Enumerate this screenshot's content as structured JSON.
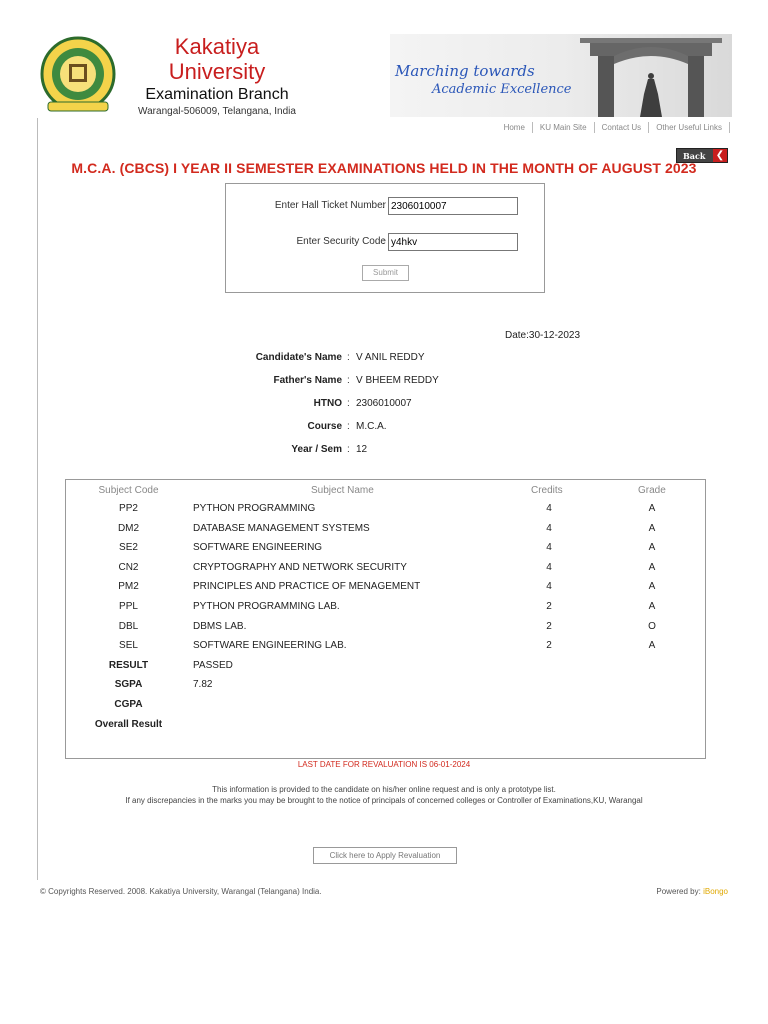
{
  "header": {
    "university_line1": "Kakatiya",
    "university_line2": "University",
    "branch": "Examination Branch",
    "address": "Warangal-506009, Telangana, India",
    "banner_line1": "Marching towards",
    "banner_line2": "Academic Excellence"
  },
  "nav": {
    "items": [
      "Home",
      "KU Main Site",
      "Contact Us",
      "Other Useful Links"
    ]
  },
  "back_label": "Back",
  "exam_title": "M.C.A. (CBCS) I YEAR II SEMESTER EXAMINATIONS HELD IN THE MONTH OF AUGUST 2023",
  "form": {
    "hall_ticket_label": "Enter Hall Ticket Number",
    "hall_ticket_value": "2306010007",
    "security_label": "Enter Security Code",
    "security_value": "y4hkv",
    "submit_label": "Submit"
  },
  "date": "Date:30-12-2023",
  "candidate": {
    "name_label": "Candidate's Name",
    "name": "V ANIL REDDY",
    "father_label": "Father's Name",
    "father": "V BHEEM REDDY",
    "htno_label": "HTNO",
    "htno": "2306010007",
    "course_label": "Course",
    "course": "M.C.A.",
    "yearsem_label": "Year / Sem",
    "yearsem": "12"
  },
  "table": {
    "headers": [
      "Subject Code",
      "Subject Name",
      "Credits",
      "Grade"
    ],
    "rows": [
      {
        "code": "PP2",
        "name": "PYTHON PROGRAMMING",
        "credits": "4",
        "grade": "A"
      },
      {
        "code": "DM2",
        "name": "DATABASE MANAGEMENT SYSTEMS",
        "credits": "4",
        "grade": "A"
      },
      {
        "code": "SE2",
        "name": "SOFTWARE ENGINEERING",
        "credits": "4",
        "grade": "A"
      },
      {
        "code": "CN2",
        "name": "CRYPTOGRAPHY AND NETWORK SECURITY",
        "credits": "4",
        "grade": "A"
      },
      {
        "code": "PM2",
        "name": "PRINCIPLES AND PRACTICE OF MENAGEMENT",
        "credits": "4",
        "grade": "A"
      },
      {
        "code": "PPL",
        "name": "PYTHON PROGRAMMING LAB.",
        "credits": "2",
        "grade": "A"
      },
      {
        "code": "DBL",
        "name": "DBMS LAB.",
        "credits": "2",
        "grade": "O"
      },
      {
        "code": "SEL",
        "name": "SOFTWARE ENGINEERING LAB.",
        "credits": "2",
        "grade": "A"
      }
    ],
    "summary": [
      {
        "label": "RESULT",
        "value": "PASSED"
      },
      {
        "label": "SGPA",
        "value": "7.82"
      },
      {
        "label": "CGPA",
        "value": ""
      },
      {
        "label": "Overall Result",
        "value": ""
      }
    ]
  },
  "revaluation_notice": "LAST DATE FOR REVALUATION IS 06-01-2024",
  "disclaimer_line1": "This information is provided to the candidate on his/her online request and is only a prototype list.",
  "disclaimer_line2": "If any discrepancies in the marks you may be brought to the notice of principals of concerned colleges or Controller of Examinations,KU, Warangal",
  "apply_revaluation_label": "Click here to Apply Revaluation",
  "footer": {
    "copyright": "© Copyrights Reserved. 2008. Kakatiya University, Warangal (Telangana) India.",
    "powered_label": "Powered by:",
    "powered_brand": "iBongo"
  },
  "colors": {
    "accent_red": "#d22a1e",
    "banner_blue": "#2a56b8",
    "powered_brand": "#e0a800"
  }
}
